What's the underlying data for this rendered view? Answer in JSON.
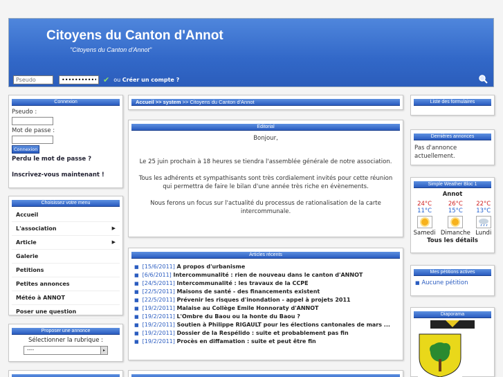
{
  "header": {
    "title": "Citoyens du Canton d'Annot",
    "slogan": "\"Citoyens du Canton d'Annot\"",
    "username_placeholder": "Pseudo",
    "password_value": "•••••••••••••",
    "or_text": "ou",
    "create_account": "Créer un compte ?"
  },
  "login_box": {
    "title": "Connexion",
    "pseudo_label": "Pseudo :",
    "password_label": "Mot de passe :",
    "button": "Connexion",
    "forgot": "Perdu le mot de passe ?",
    "register": "Inscrivez-vous maintenant !"
  },
  "menu": {
    "title": "Choisissez votre menu",
    "items": [
      {
        "label": "Accueil",
        "has_sub": false
      },
      {
        "label": "L'association",
        "has_sub": true
      },
      {
        "label": "Article",
        "has_sub": true
      },
      {
        "label": "Galerie",
        "has_sub": false
      },
      {
        "label": "Petitions",
        "has_sub": false
      },
      {
        "label": "Petites annonces",
        "has_sub": false
      },
      {
        "label": "Météo à ANNOT",
        "has_sub": false
      },
      {
        "label": "Poser une question",
        "has_sub": false
      }
    ]
  },
  "propose": {
    "title": "Proposer une annonce",
    "select_label": "Sélectionner la rubrique :",
    "select_value": "----"
  },
  "breadcrumb": {
    "home": "Accueil",
    "sep1": ">>",
    "system": "system",
    "sep2": ">>",
    "current": "Citoyens du Canton d'Annot"
  },
  "editorial": {
    "title": "Editorial",
    "greeting": "Bonjour,",
    "p1": "Le 25 juin prochain à 18 heures se tiendra l'assemblée générale de notre association.",
    "p2": "Tous les adhérents et sympathisants sont très cordialement invités pour cette réunion qui permettra de faire le bilan d'une année très riche en évènements.",
    "p3": "Nous ferons un focus sur l'actualité du processus de rationalisation de la carte intercommunale."
  },
  "recent": {
    "title": "Articles récents",
    "items": [
      {
        "date": "[15/6/2011]",
        "title": "A propos d'urbanisme"
      },
      {
        "date": "[6/6/2011]",
        "title": "Intercommunalité : rien de nouveau dans le canton d'ANNOT"
      },
      {
        "date": "[24/5/2011]",
        "title": "Intercommunalité : les travaux de la CCPE"
      },
      {
        "date": "[22/5/2011]",
        "title": "Maisons de santé - des financements existent"
      },
      {
        "date": "[22/5/2011]",
        "title": "Prévenir les risques d'inondation - appel à projets 2011"
      },
      {
        "date": "[19/2/2011]",
        "title": "Malaise au Collège Emile Honnoraty d'ANNOT"
      },
      {
        "date": "[19/2/2011]",
        "title": "L'Ombre du Baou ou la honte du Baou ?"
      },
      {
        "date": "[19/2/2011]",
        "title": "Soutien à Philippe RIGAULT pour les élections cantonales de mars ..."
      },
      {
        "date": "[19/2/2011]",
        "title": "Dossier de la Respélido : suite et probablement pas fin"
      },
      {
        "date": "[19/2/2011]",
        "title": "Procès en diffamation : suite et peut être fin"
      }
    ]
  },
  "forms_box": {
    "title": "Liste des formulaires"
  },
  "ads_box": {
    "title": "Dernières annonces",
    "text": "Pas d'annonce actuellement."
  },
  "weather": {
    "title": "Simple Weather Bloc 1",
    "city": "Annot",
    "days": [
      {
        "max": "24°C",
        "min": "11°C",
        "label": "Samedi",
        "icon": "sun-icon"
      },
      {
        "max": "26°C",
        "min": "15°C",
        "label": "Dimanche",
        "icon": "sun-icon"
      },
      {
        "max": "22°C",
        "min": "13°C",
        "label": "Lundi",
        "icon": "rain-icon"
      }
    ],
    "details": "Tous les détails"
  },
  "petitions": {
    "title": "Mes pétitions actives",
    "item": "Aucune pétition"
  },
  "diaporama": {
    "title": "Diaporama"
  }
}
